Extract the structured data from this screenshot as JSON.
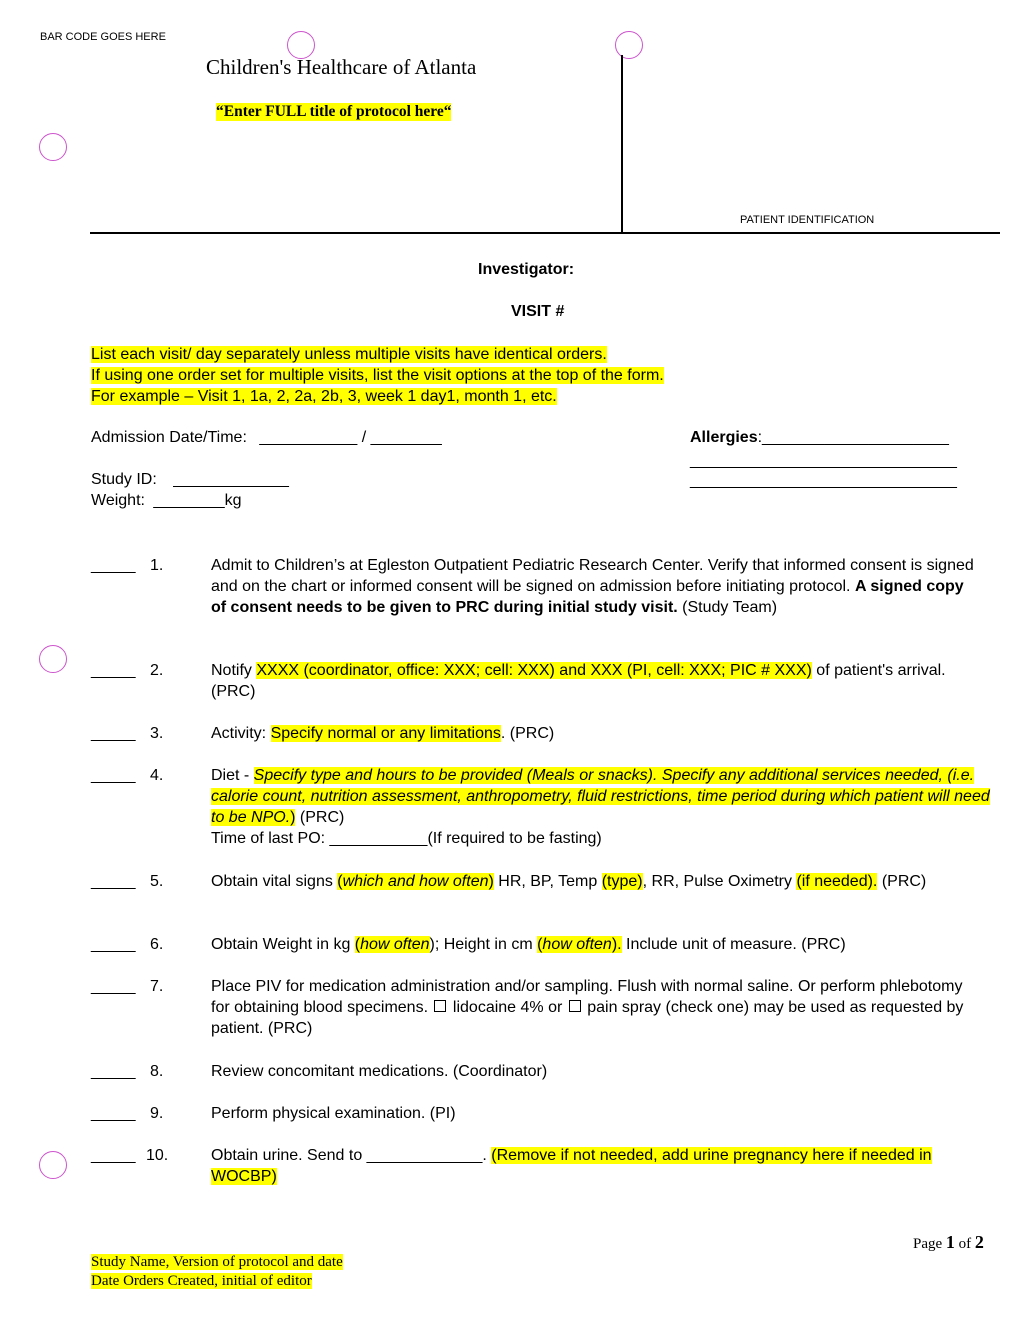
{
  "header": {
    "barcode_label": "BAR CODE GOES HERE",
    "organization": "Children's Healthcare of Atlanta",
    "protocol_title": "“Enter FULL title of protocol here“",
    "patient_identification_label": "PATIENT IDENTIFICATION"
  },
  "investigator_label": "Investigator:",
  "visit_label": "VISIT #",
  "instructions": [
    "List each visit/ day separately unless multiple visits have identical orders.",
    "If using one order set for multiple visits, list the visit options at the top of the form.",
    "For example – Visit 1, 1a, 2, 2a, 2b, 3, week 1 day1, month 1, etc."
  ],
  "fields": {
    "admission_label": "Admission Date/Time:",
    "admission_date_value": "___________",
    "admission_separator": "/",
    "admission_time_value": "________",
    "allergies_label": "Allergies",
    "allergies_value": ":_____________________",
    "allergies_line2": "______________________________",
    "allergies_line3": "______________________________",
    "study_id_label": "Study ID:",
    "study_id_value": "_____________",
    "weight_label": "Weight:",
    "weight_value": "________",
    "weight_unit": "kg"
  },
  "orders": [
    {
      "blank": "_____",
      "number": "1.",
      "text_a": "Admit to Children’s at Egleston Outpatient Pediatric Research Center. Verify that informed consent is signed and on the chart or informed consent will be signed on admission before initiating protocol. ",
      "bold": "A signed copy of consent needs to be given to PRC during initial study visit.",
      "text_b": "  (Study Team)"
    },
    {
      "blank": "_____",
      "number": "2.",
      "text_a": "Notify ",
      "highlight": "XXXX (coordinator, office:  XXX; cell:  XXX) and XXX (PI, cell:  XXX; PIC # XXX)",
      "text_b": " of patient's arrival.  (PRC)"
    },
    {
      "blank": "_____",
      "number": "3.",
      "text_a": "Activity:  ",
      "highlight": "Specify normal or any limitations",
      "text_b": ".  (PRC)"
    },
    {
      "blank": "_____",
      "number": "4.",
      "text_a": "Diet - ",
      "highlight": "Specify type and hours to be provided (Meals or snacks).  Specify any additional services needed, (i.e. calorie count, nutrition assessment, anthropometry, fluid restrictions, time period during which patient will need to be NPO.",
      "highlight_tail": ")",
      "text_b": " (PRC)",
      "line2_label": "Time of last PO:  ",
      "line2_blank": "___________",
      "line2_note": "(If required to be fasting)"
    },
    {
      "blank": "_____",
      "number": "5.",
      "text_a": "Obtain vital signs ",
      "hl1_open": "(",
      "hl1_italic": "which and how often",
      "hl1_close": ")",
      "text_b": " HR, BP, Temp ",
      "hl2": "(type)",
      "text_c": ", RR, Pulse Oximetry ",
      "hl3": "(if needed).",
      "text_d": " (PRC)"
    },
    {
      "blank": "_____",
      "number": "6.",
      "text_a": "Obtain Weight in kg ",
      "hl1_open": "(",
      "hl1_italic": "how often",
      "hl1_close": ")",
      "text_b": "; Height in cm ",
      "hl2_open": "(",
      "hl2_italic": "how often",
      "hl2_close": ").",
      "text_c": " Include unit of measure. (PRC)"
    },
    {
      "blank": "_____",
      "number": "7.",
      "text_a": "Place PIV for medication administration and/or sampling. Flush with normal saline. Or perform phlebotomy for obtaining blood specimens. ",
      "option1": "lidocaine 4% or ",
      "option2": "pain spray (check one) may be used as requested by patient.  (PRC)"
    },
    {
      "blank": "_____",
      "number": "8.",
      "text_a": "Review concomitant medications.  (Coordinator)"
    },
    {
      "blank": "_____",
      "number": "9.",
      "text_a": "Perform physical examination.  (PI)"
    },
    {
      "blank": "_____",
      "number": "10.",
      "text_a": "Obtain urine.  Send to _____________.  ",
      "highlight": "(Remove if not needed, add urine pregnancy here if needed in WOCBP)"
    }
  ],
  "page": {
    "prefix": "Page ",
    "current": "1",
    "of": " of ",
    "total": "2"
  },
  "footer": {
    "line1": "Study Name, Version of protocol and date",
    "line2": "Date Orders Created, initial of editor"
  },
  "colors": {
    "highlight": "#ffff00",
    "punch_hole": "#cc55cc"
  }
}
